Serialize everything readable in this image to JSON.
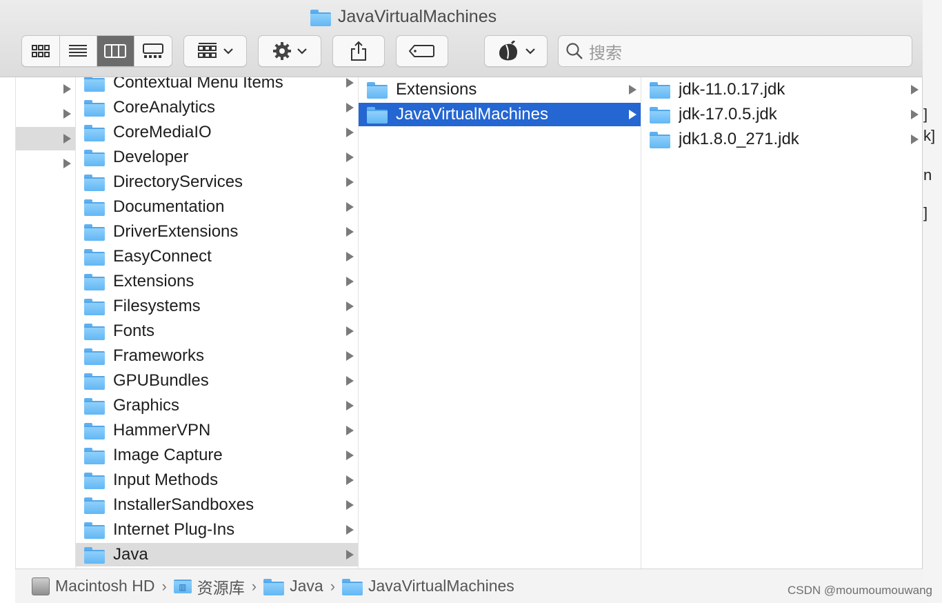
{
  "window": {
    "title": "JavaVirtualMachines"
  },
  "toolbar": {
    "view_modes": [
      "icon-view",
      "list-view",
      "column-view",
      "gallery-view"
    ],
    "active_view": "column-view",
    "search_placeholder": "搜索"
  },
  "columns": {
    "col1": [
      "Contextual Menu Items",
      "CoreAnalytics",
      "CoreMediaIO",
      "Developer",
      "DirectoryServices",
      "Documentation",
      "DriverExtensions",
      "EasyConnect",
      "Extensions",
      "Filesystems",
      "Fonts",
      "Frameworks",
      "GPUBundles",
      "Graphics",
      "HammerVPN",
      "Image Capture",
      "Input Methods",
      "InstallerSandboxes",
      "Internet Plug-Ins",
      "Java"
    ],
    "col1_selected": "Java",
    "col2": [
      "Extensions",
      "JavaVirtualMachines"
    ],
    "col2_selected": "JavaVirtualMachines",
    "col3": [
      "jdk-11.0.17.jdk",
      "jdk-17.0.5.jdk",
      "jdk1.8.0_271.jdk"
    ]
  },
  "pathbar": {
    "items": [
      "Macintosh HD",
      "资源库",
      "Java",
      "JavaVirtualMachines"
    ]
  },
  "edge": {
    "fragments": [
      "]",
      "k]",
      "n",
      "]"
    ]
  },
  "watermark": "CSDN @moumoumouwang",
  "colors": {
    "selection_blue": "#2466d2",
    "folder_blue": "#62b7f4"
  }
}
